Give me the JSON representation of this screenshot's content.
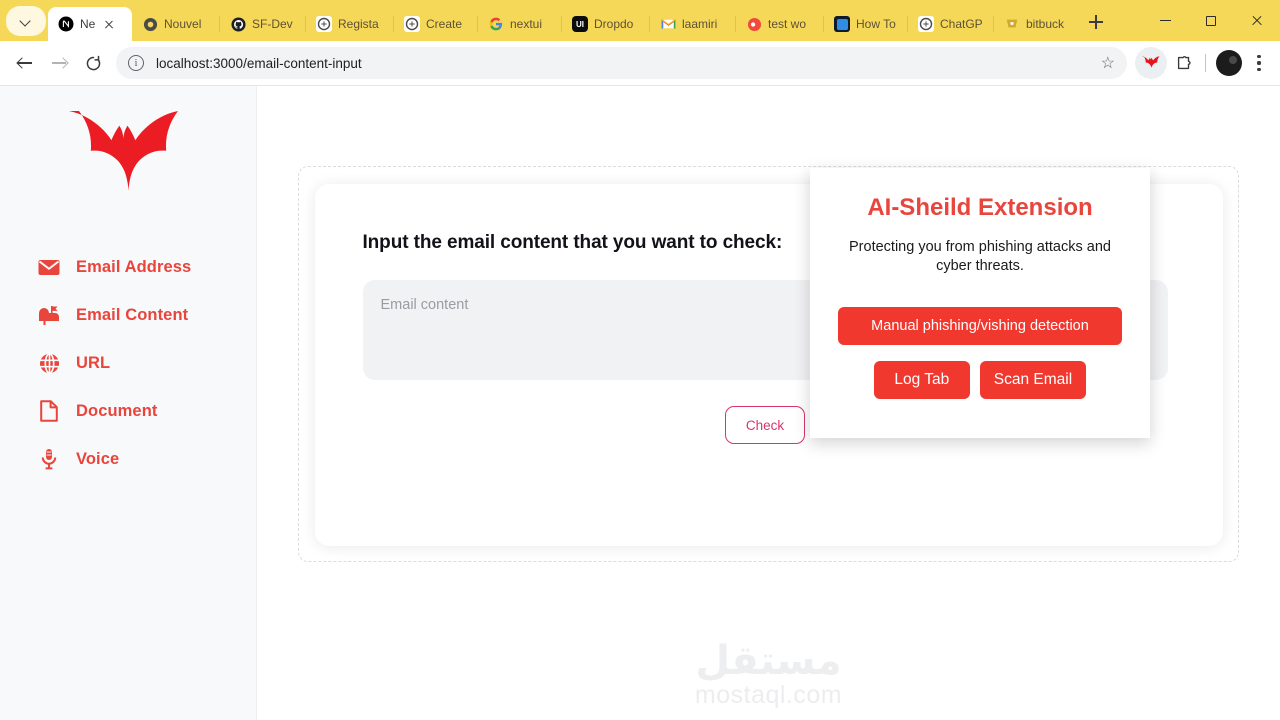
{
  "browser": {
    "tab_search_tooltip": "Search tabs",
    "tabs": [
      {
        "title": "Ne",
        "favicon": "nextjs-icon",
        "active": true
      },
      {
        "title": "Nouvel",
        "favicon": "chrome-icon",
        "active": false
      },
      {
        "title": "SF-Dev",
        "favicon": "github-icon",
        "active": false
      },
      {
        "title": "Regista",
        "favicon": "openai-icon",
        "active": false
      },
      {
        "title": "Create",
        "favicon": "openai-icon",
        "active": false
      },
      {
        "title": "nextui",
        "favicon": "google-icon",
        "active": false
      },
      {
        "title": "Dropdo",
        "favicon": "nextui-icon",
        "active": false
      },
      {
        "title": "laamiri",
        "favicon": "gmail-icon",
        "active": false
      },
      {
        "title": "test wo",
        "favicon": "invision-icon",
        "active": false
      },
      {
        "title": "How To",
        "favicon": "blue-app-icon",
        "active": false
      },
      {
        "title": "ChatGP",
        "favicon": "openai-icon",
        "active": false
      },
      {
        "title": "bitbuck",
        "favicon": "bitbucket-icon",
        "active": false
      }
    ],
    "new_tab_label": "+",
    "window_controls": {
      "minimize": "minimize-icon",
      "maximize": "maximize-icon",
      "close": "close-icon"
    },
    "toolbar": {
      "back": "back-arrow-icon",
      "forward": "forward-arrow-icon",
      "reload": "reload-icon",
      "site_info": "site-info-icon",
      "url": "localhost:3000/email-content-input",
      "bookmark": "★",
      "extension_active": "ai-sheild-extension-icon",
      "extensions_puzzle": "puzzle-icon",
      "profile": "profile-avatar",
      "menu": "kebab-menu-icon"
    }
  },
  "sidebar": {
    "logo_name": "bat-logo",
    "items": [
      {
        "label": "Email Address",
        "icon": "envelope-icon"
      },
      {
        "label": "Email Content",
        "icon": "mailbox-icon"
      },
      {
        "label": "URL",
        "icon": "globe-icon"
      },
      {
        "label": "Document",
        "icon": "document-icon"
      },
      {
        "label": "Voice",
        "icon": "microphone-icon"
      }
    ],
    "accent_color": "#e8453c",
    "background_color": "#f8f9fb"
  },
  "main": {
    "card_title": "Input the email content that you want to check:",
    "textarea_placeholder": "Email content",
    "textarea_value": "",
    "check_button_label": "Check",
    "check_button_color": "#d8356b"
  },
  "watermark": {
    "arabic": "مستقل",
    "latin": "mostaql.com"
  },
  "popup": {
    "title": "AI-Sheild Extension",
    "subtitle": "Protecting you from phishing attacks and cyber threats.",
    "primary_button": "Manual phishing/vishing detection",
    "secondary_buttons": [
      "Log Tab",
      "Scan Email"
    ],
    "button_color": "#f0382f",
    "title_color": "#e8453c"
  }
}
